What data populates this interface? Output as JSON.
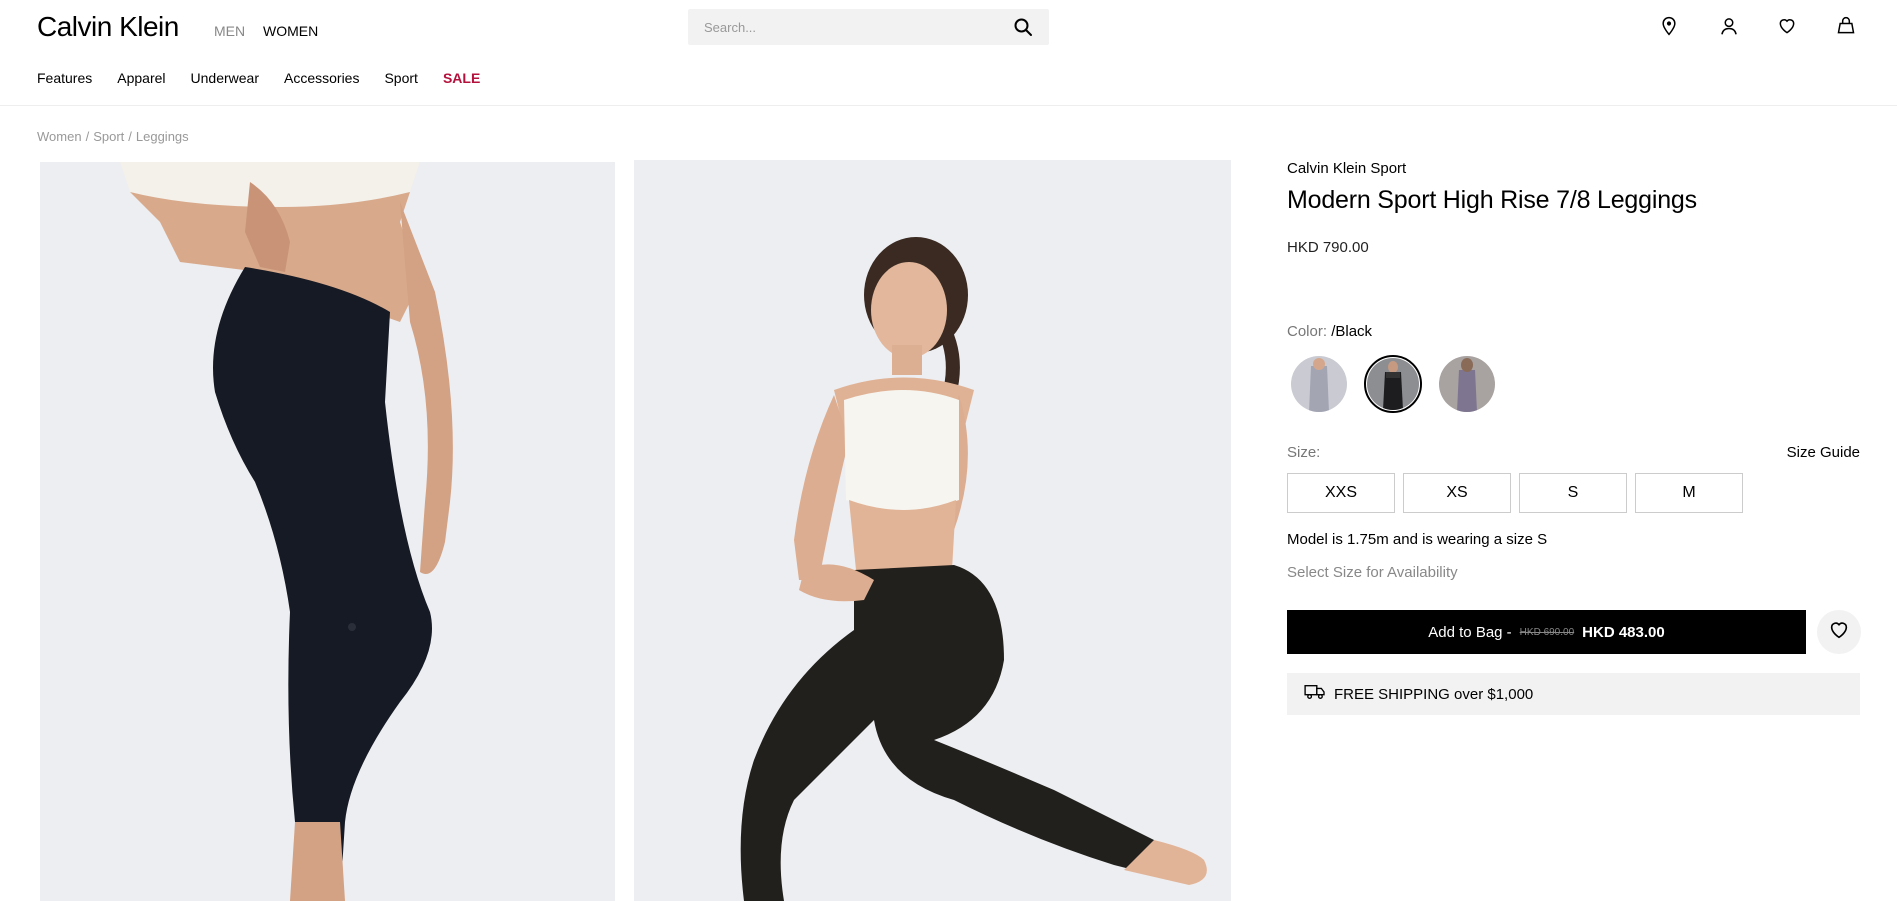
{
  "header": {
    "logo": "Calvin Klein",
    "gender_men": "MEN",
    "gender_women": "WOMEN",
    "search_placeholder": "Search...",
    "icons": [
      "location-icon",
      "account-icon",
      "wishlist-icon",
      "bag-icon"
    ]
  },
  "nav": {
    "items": [
      "Features",
      "Apparel",
      "Underwear",
      "Accessories",
      "Sport",
      "SALE"
    ]
  },
  "breadcrumb": [
    "Women",
    "Sport",
    "Leggings"
  ],
  "breadcrumb_sep": "/",
  "product": {
    "brand": "Calvin Klein Sport",
    "title": "Modern Sport High Rise 7/8 Leggings",
    "price": "HKD 790.00",
    "color_label": "Color:",
    "color_value": "/Black",
    "swatches": [
      {
        "name": "light-grey",
        "color": "#a9aab5",
        "selected": false
      },
      {
        "name": "black",
        "color": "#2a2a2c",
        "selected": true
      },
      {
        "name": "purple-grey",
        "color": "#8a8395",
        "selected": false
      }
    ],
    "size_label": "Size:",
    "size_guide": "Size Guide",
    "sizes": [
      "XXS",
      "XS",
      "S",
      "M"
    ],
    "model_note": "Model is 1.75m and is wearing a size S",
    "availability": "Select Size for Availability",
    "add_to_bag": "Add to Bag -",
    "old_price": "HKD 690.00",
    "new_price": "HKD 483.00",
    "shipping": "FREE SHIPPING over $1,000"
  },
  "colors": {
    "sale": "#b4123c",
    "button_bg": "#000000",
    "panel_bg": "#f2f2f2",
    "image_bg": "#edeef2"
  }
}
